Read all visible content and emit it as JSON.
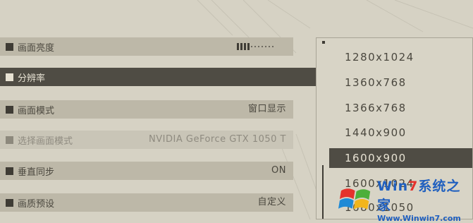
{
  "settings": {
    "rows": [
      {
        "label": "画面亮度",
        "value": ""
      },
      {
        "label": "分辨率",
        "value": ""
      },
      {
        "label": "画面模式",
        "value": "窗口显示"
      },
      {
        "label": "选择画面模式",
        "value": "NVIDIA GeForce GTX 1050 T"
      },
      {
        "label": "垂直同步",
        "value": "ON"
      },
      {
        "label": "画质预设",
        "value": "自定义"
      }
    ],
    "brightness_level": 0.35
  },
  "dropdown": {
    "options": [
      "1280x1024",
      "1360x768",
      "1366x768",
      "1440x900",
      "1600x900",
      "1600x1024",
      "1680x1050"
    ],
    "selected": "1600x900"
  },
  "watermark": {
    "title_prefix": "Win",
    "title_seven": "7",
    "title_suffix": "系统之家",
    "url": "Www.Winwin7.com"
  },
  "colors": {
    "background": "#d6d2c4",
    "row": "#bdb8a8",
    "selected": "#4f4c44",
    "text": "#4a473e"
  }
}
